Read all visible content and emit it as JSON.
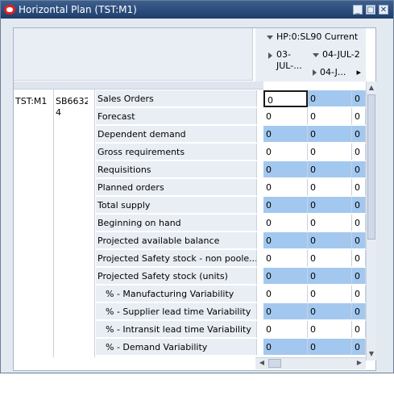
{
  "window": {
    "title": "Horizontal Plan (TST:M1)"
  },
  "columns": {
    "plan_header": "HP:0:SL90  Current",
    "date1": "03-JUL-...",
    "date2": "04-JUL-2",
    "date2_sub": "04-J..."
  },
  "row_keys": {
    "org": "TST:M1",
    "item": "SB6632 4"
  },
  "rows": [
    {
      "label": "Sales Orders",
      "values": [
        "0",
        "0",
        "0"
      ]
    },
    {
      "label": "Forecast",
      "values": [
        "0",
        "0",
        "0"
      ]
    },
    {
      "label": "Dependent demand",
      "values": [
        "0",
        "0",
        "0"
      ]
    },
    {
      "label": "Gross requirements",
      "values": [
        "0",
        "0",
        "0"
      ]
    },
    {
      "label": "Requisitions",
      "values": [
        "0",
        "0",
        "0"
      ]
    },
    {
      "label": "Planned orders",
      "values": [
        "0",
        "0",
        "0"
      ]
    },
    {
      "label": "Total supply",
      "values": [
        "0",
        "0",
        "0"
      ]
    },
    {
      "label": "Beginning on hand",
      "values": [
        "0",
        "0",
        "0"
      ]
    },
    {
      "label": "Projected available balance",
      "values": [
        "0",
        "0",
        "0"
      ]
    },
    {
      "label": "Projected Safety stock - non poole...",
      "values": [
        "0",
        "0",
        "0"
      ]
    },
    {
      "label": "Projected Safety stock (units)",
      "values": [
        "0",
        "0",
        "0"
      ]
    },
    {
      "label": "% - Manufacturing Variability",
      "values": [
        "0",
        "0",
        "0"
      ]
    },
    {
      "label": "% - Supplier lead time Variability",
      "values": [
        "0",
        "0",
        "0"
      ]
    },
    {
      "label": "% - Intransit lead time Variability",
      "values": [
        "0",
        "0",
        "0"
      ]
    },
    {
      "label": "% - Demand Variability",
      "values": [
        "0",
        "0",
        "0"
      ]
    }
  ],
  "colors": {
    "titlebar": "#1e3d6b",
    "cell_blue": "#a3c8ef"
  }
}
